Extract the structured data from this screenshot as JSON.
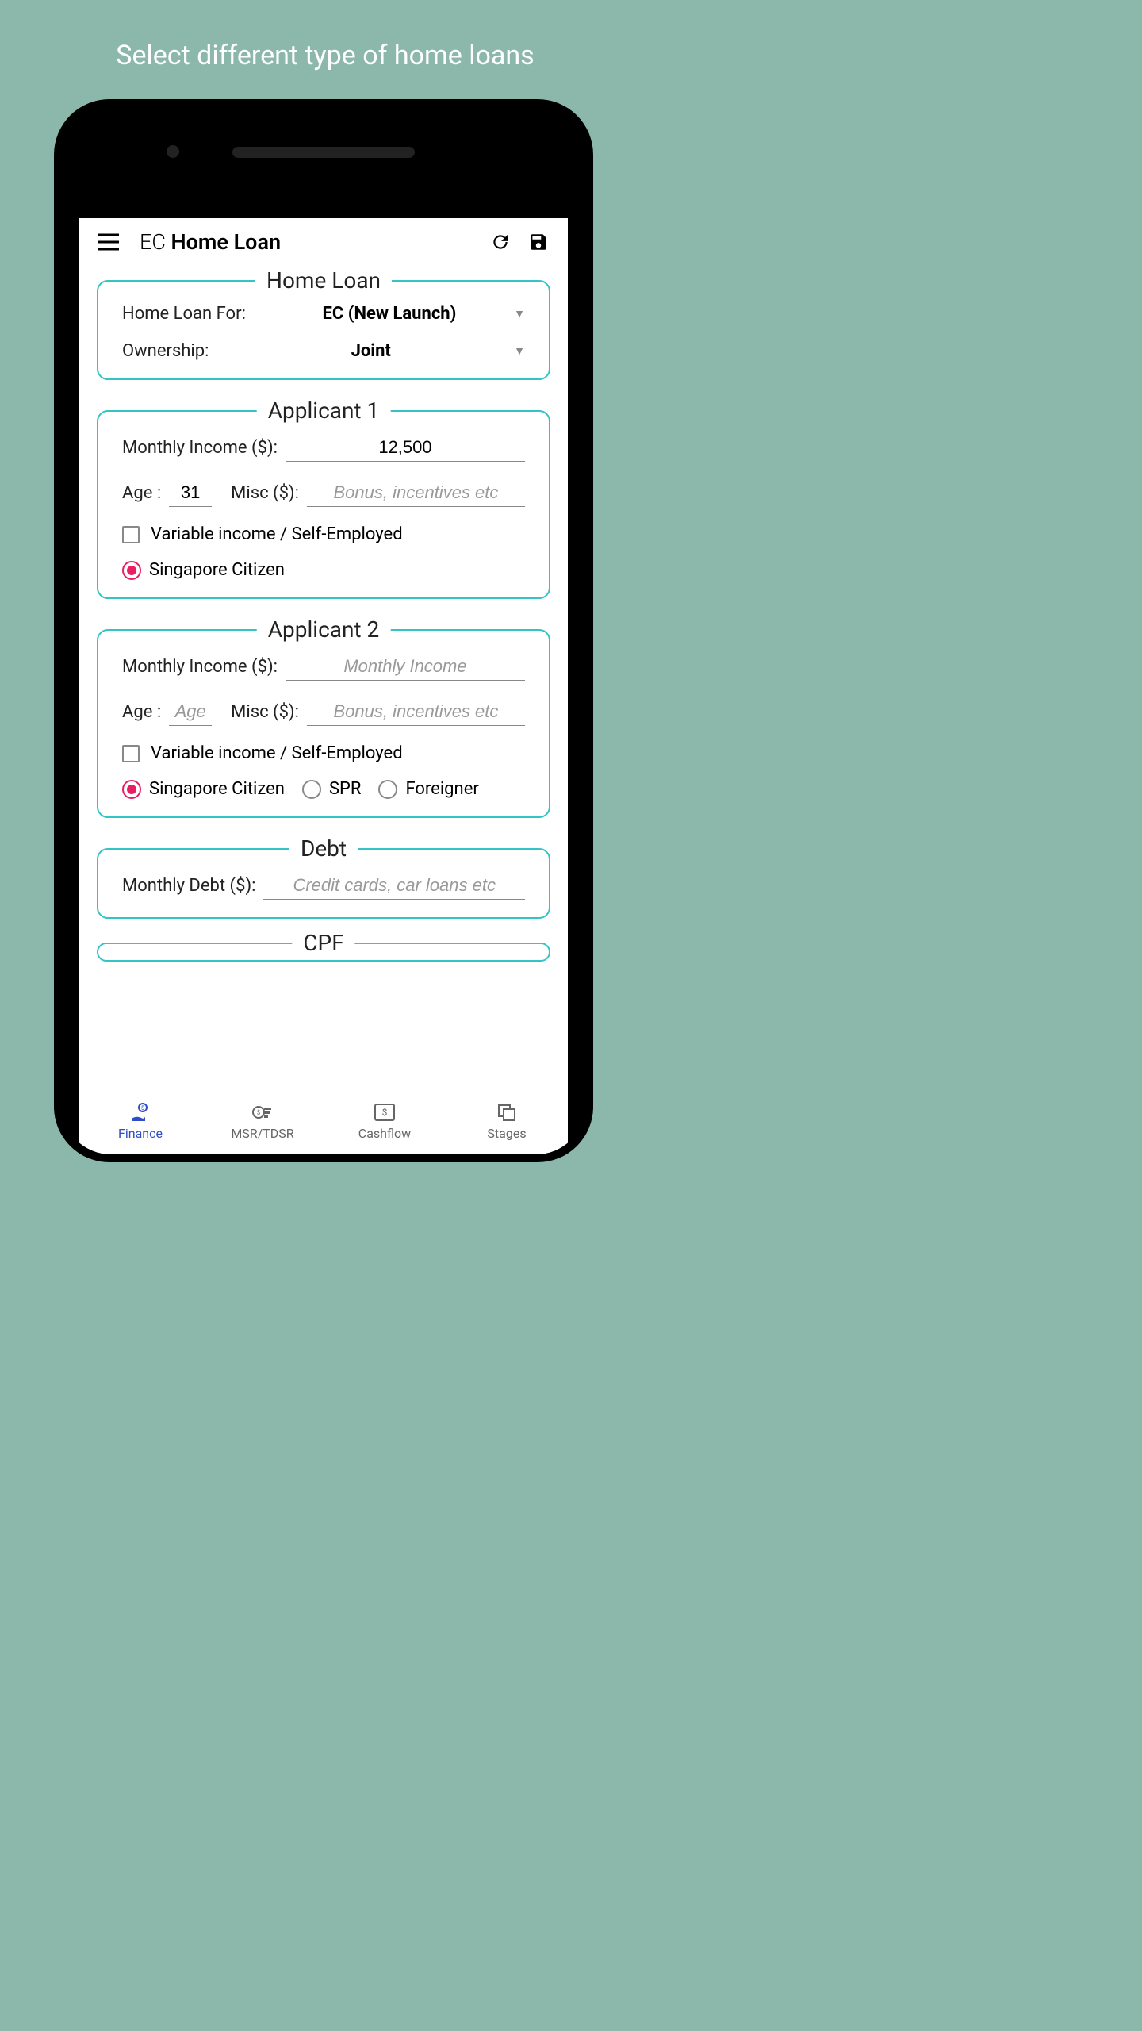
{
  "promo": {
    "title": "Select different type of home loans"
  },
  "toolbar": {
    "title_prefix": "EC ",
    "title_bold": "Home Loan"
  },
  "homeLoan": {
    "legend": "Home Loan",
    "loanForLabel": "Home Loan For:",
    "loanForValue": "EC (New Launch)",
    "ownershipLabel": "Ownership:",
    "ownershipValue": "Joint"
  },
  "applicant1": {
    "legend": "Applicant 1",
    "incomeLabel": "Monthly Income ($):",
    "incomeValue": "12,500",
    "ageLabel": "Age :",
    "ageValue": "31",
    "miscLabel": "Misc ($):",
    "miscPlaceholder": "Bonus, incentives etc",
    "variableLabel": "Variable income / Self-Employed",
    "citizenLabel": "Singapore Citizen"
  },
  "applicant2": {
    "legend": "Applicant 2",
    "incomeLabel": "Monthly Income ($):",
    "incomePlaceholder": "Monthly Income",
    "ageLabel": "Age :",
    "agePlaceholder": "Age",
    "miscLabel": "Misc ($):",
    "miscPlaceholder": "Bonus, incentives etc",
    "variableLabel": "Variable income / Self-Employed",
    "citizenLabel": "Singapore Citizen",
    "sprLabel": "SPR",
    "foreignerLabel": "Foreigner"
  },
  "debt": {
    "legend": "Debt",
    "label": "Monthly Debt ($):",
    "placeholder": "Credit cards, car loans etc"
  },
  "cpf": {
    "legend": "CPF"
  },
  "nav": {
    "finance": "Finance",
    "msr": "MSR/TDSR",
    "cashflow": "Cashflow",
    "stages": "Stages"
  }
}
